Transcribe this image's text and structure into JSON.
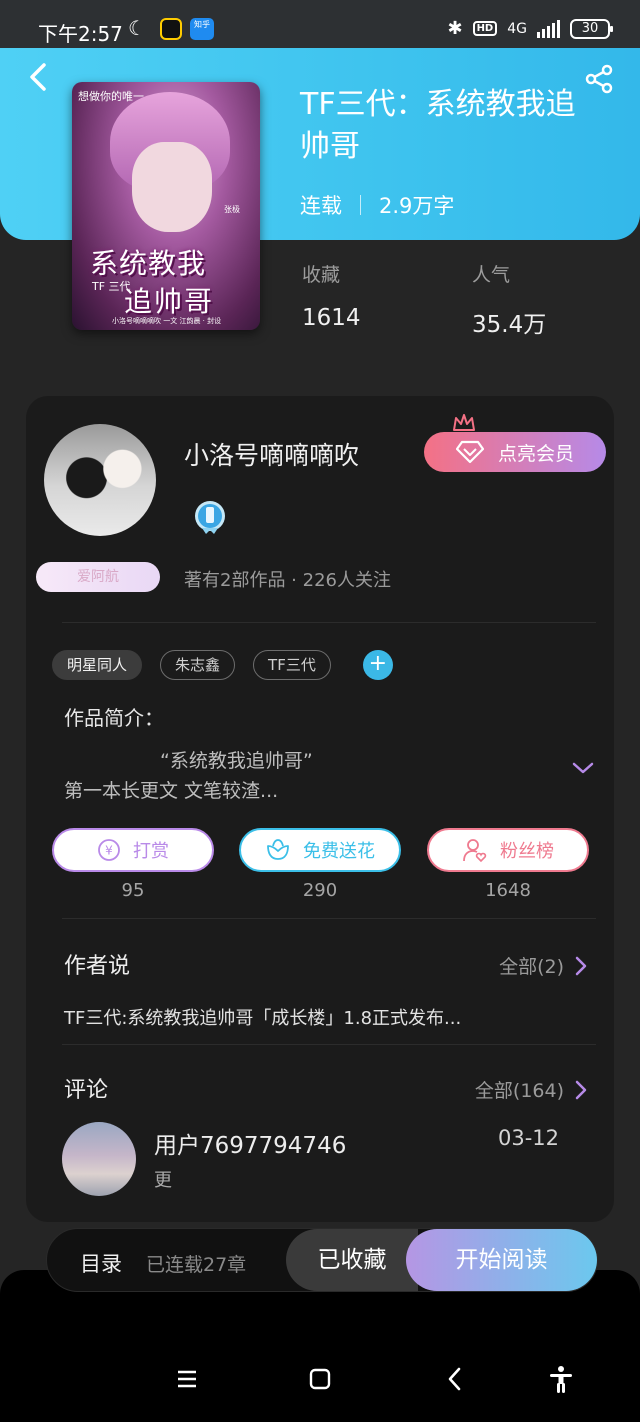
{
  "status_bar": {
    "time": "下午2:57",
    "network": "4G",
    "battery": "30",
    "hd": "HD",
    "app_badge": "知乎"
  },
  "book": {
    "title": "TF三代：系统教我追帅哥",
    "status": "连载",
    "word_count": "2.9万字",
    "cover": {
      "tagline": "想做你的唯一",
      "title_line1": "系统教我",
      "title_line2": "追帅哥",
      "tf": "TF 三代",
      "credit": "小洛号嘀嘀嘀吹 一文   江韵晨 · 封设",
      "signature": "张极"
    }
  },
  "stats": [
    {
      "label": "收藏",
      "value": "1614"
    },
    {
      "label": "人气",
      "value": "35.4万"
    }
  ],
  "author": {
    "name": "小洛号嘀嘀嘀吹",
    "badge": "爱阿航",
    "stats": "著有2部作品 · 226人关注",
    "vip_label": "点亮会员"
  },
  "tags": [
    "明星同人",
    "朱志鑫",
    "TF三代"
  ],
  "intro": {
    "label": "作品简介：",
    "line1": "“系统教我追帅哥”",
    "line2": "第一本长更文 文笔较渣..."
  },
  "actions": [
    {
      "label": "打赏",
      "count": "95",
      "color": "#b98ae8"
    },
    {
      "label": "免费送花",
      "count": "290",
      "color": "#3bbfe8"
    },
    {
      "label": "粉丝榜",
      "count": "1648",
      "color": "#ef7a8f"
    }
  ],
  "author_says": {
    "title": "作者说",
    "more": "全部(2)",
    "post": "TF三代:系统教我追帅哥「成长楼」1.8正式发布..."
  },
  "comments": {
    "title": "评论",
    "more": "全部(164)",
    "user": "用户7697794746",
    "date": "03-12",
    "text": "更"
  },
  "bottom_bar": {
    "toc": "目录",
    "chapters": "已连载27章",
    "collected": "已收藏",
    "read": "开始阅读"
  },
  "colors": {
    "header": "#3ec3ee",
    "accent_blue": "#3bb8e6",
    "vip_gradient_start": "#f47185",
    "vip_gradient_end": "#b68ae8"
  }
}
